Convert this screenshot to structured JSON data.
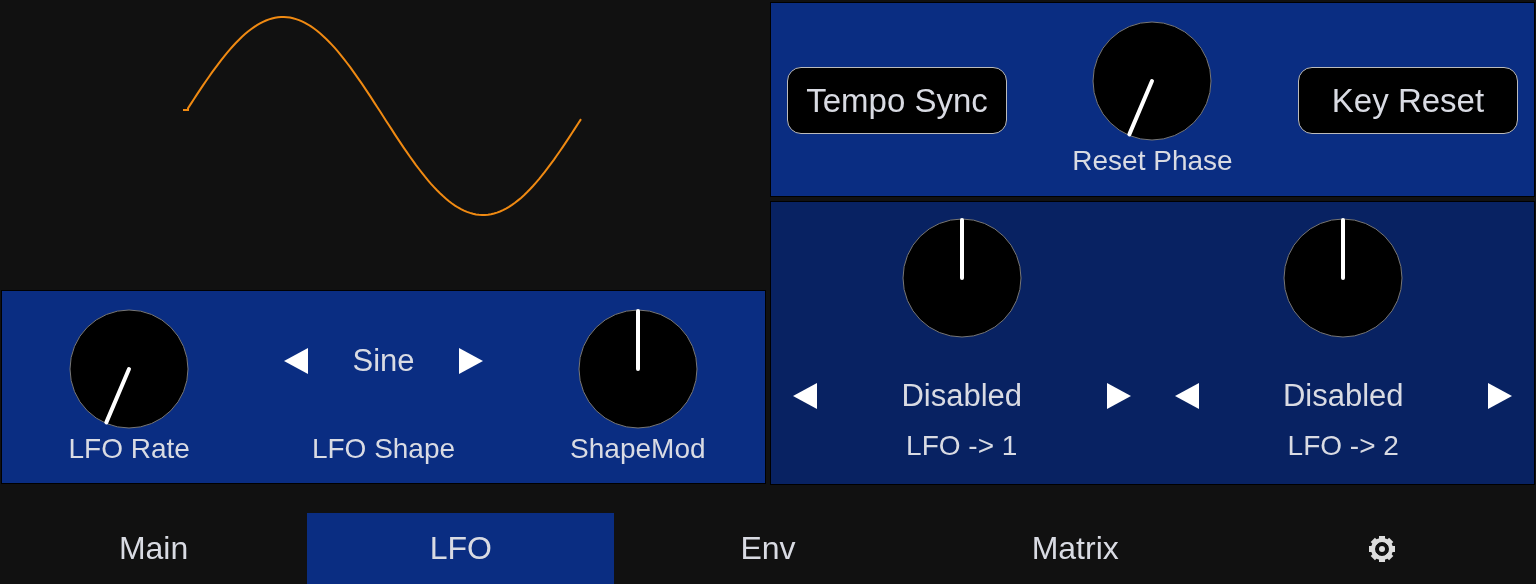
{
  "lfo_controls": [
    {
      "kind": "knob",
      "label": "LFO Rate"
    },
    {
      "kind": "selector",
      "value": "Sine",
      "label": "LFO Shape"
    },
    {
      "kind": "knob",
      "label": "ShapeMod"
    }
  ],
  "sync_controls": [
    {
      "kind": "button",
      "label": "Tempo Sync"
    },
    {
      "kind": "knob",
      "label": "Reset Phase"
    },
    {
      "kind": "button",
      "label": "Key Reset"
    }
  ],
  "destinations": [
    {
      "value": "Disabled",
      "label": "LFO -> 1"
    },
    {
      "value": "Disabled",
      "label": "LFO -> 2"
    }
  ],
  "tabs": [
    {
      "kind": "text",
      "label": "Main",
      "selected": false
    },
    {
      "kind": "text",
      "label": "LFO",
      "selected": true
    },
    {
      "kind": "text",
      "label": "Env",
      "selected": false
    },
    {
      "kind": "text",
      "label": "Matrix",
      "selected": false
    },
    {
      "kind": "settings",
      "selected": false
    }
  ]
}
